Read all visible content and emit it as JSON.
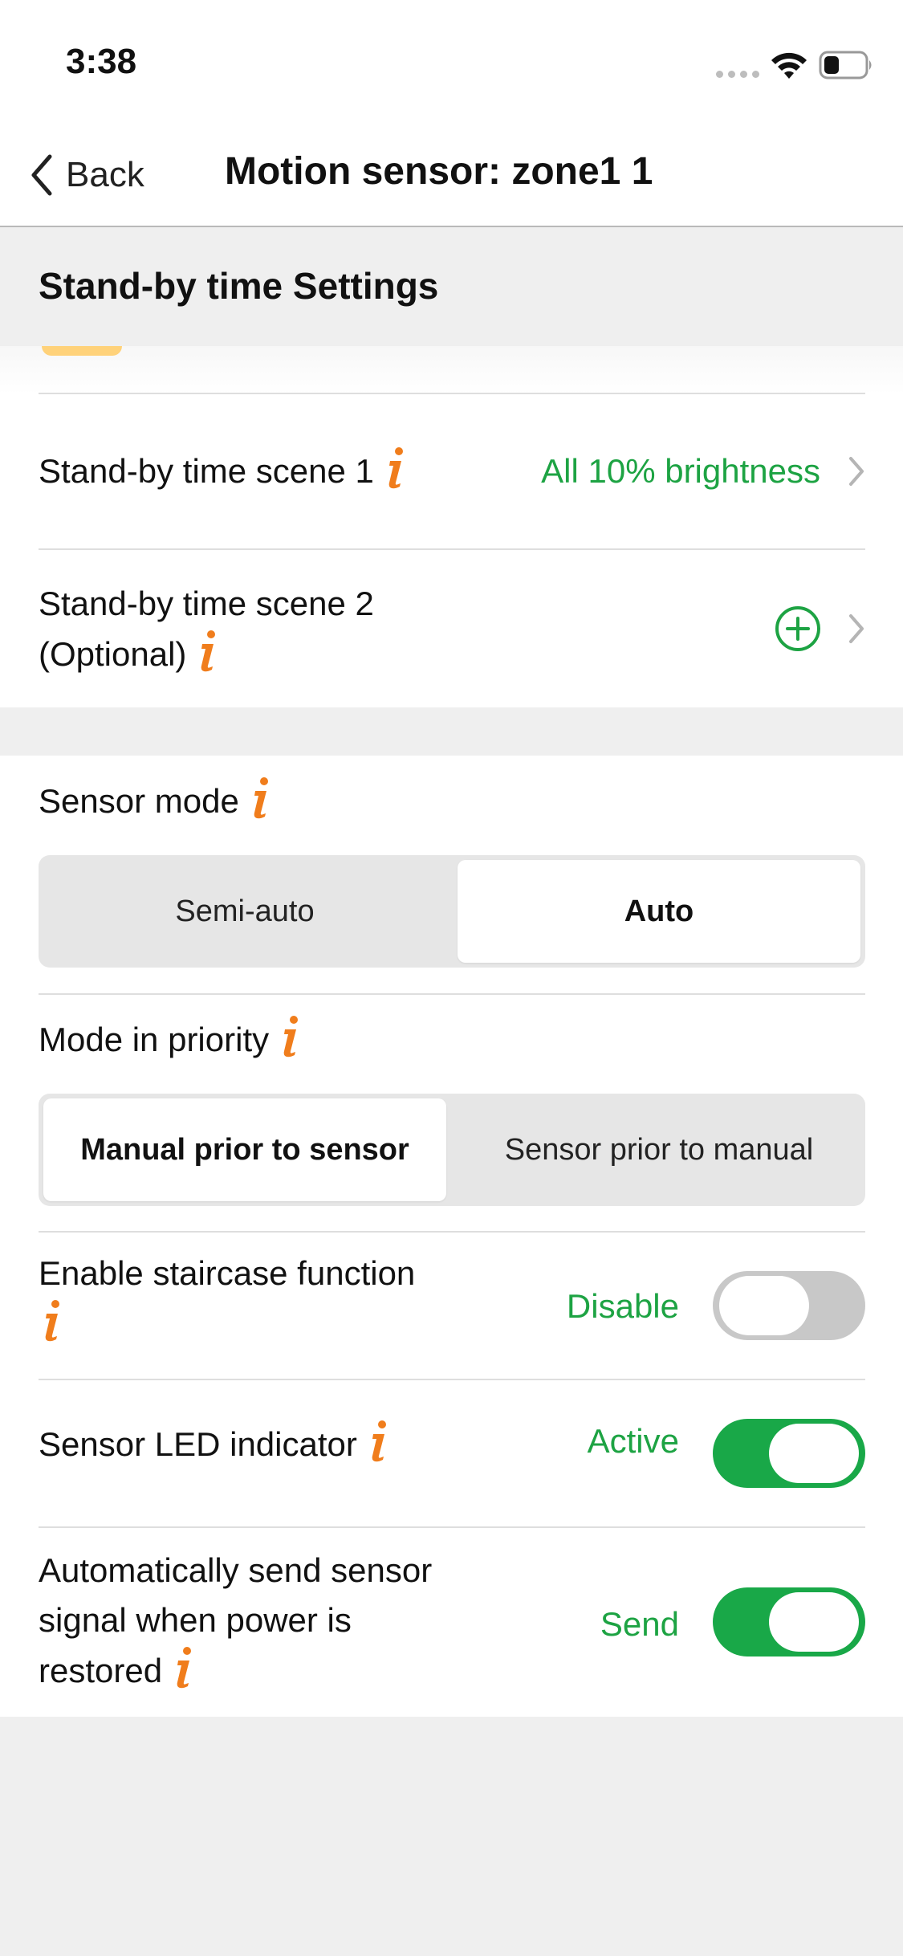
{
  "status_bar": {
    "time": "3:38"
  },
  "nav": {
    "back_label": "Back",
    "title": "Motion sensor: zone1 1"
  },
  "section": {
    "title": "Stand-by time Settings"
  },
  "standby_rows": [
    {
      "label": "Stand-by time scene 1",
      "value": "All 10% brightness"
    },
    {
      "label_line1": "Stand-by time scene 2",
      "label_line2": "(Optional)"
    }
  ],
  "sensor_mode": {
    "label": "Sensor mode",
    "options": [
      "Semi-auto",
      "Auto"
    ],
    "selected": "Auto"
  },
  "mode_priority": {
    "label": "Mode in priority",
    "options": [
      "Manual prior to sensor",
      "Sensor prior to manual"
    ],
    "selected": "Manual prior to sensor"
  },
  "staircase": {
    "label": "Enable staircase function",
    "status": "Disable",
    "enabled": false
  },
  "led_indicator": {
    "label": "Sensor LED indicator",
    "status": "Active",
    "enabled": true
  },
  "power_restore": {
    "label_line1": "Automatically send sensor",
    "label_line2": "signal when power is",
    "label_line3": "restored",
    "status": "Send",
    "enabled": true
  },
  "colors": {
    "accent_green": "#1da343",
    "info_orange": "#f07d1c",
    "toggle_on": "#19a848",
    "toggle_off": "#c8c8c8"
  },
  "icons": [
    "wifi-icon",
    "battery-icon",
    "back-chevron-icon",
    "info-icon",
    "chevron-right-icon",
    "add-circle-icon"
  ]
}
